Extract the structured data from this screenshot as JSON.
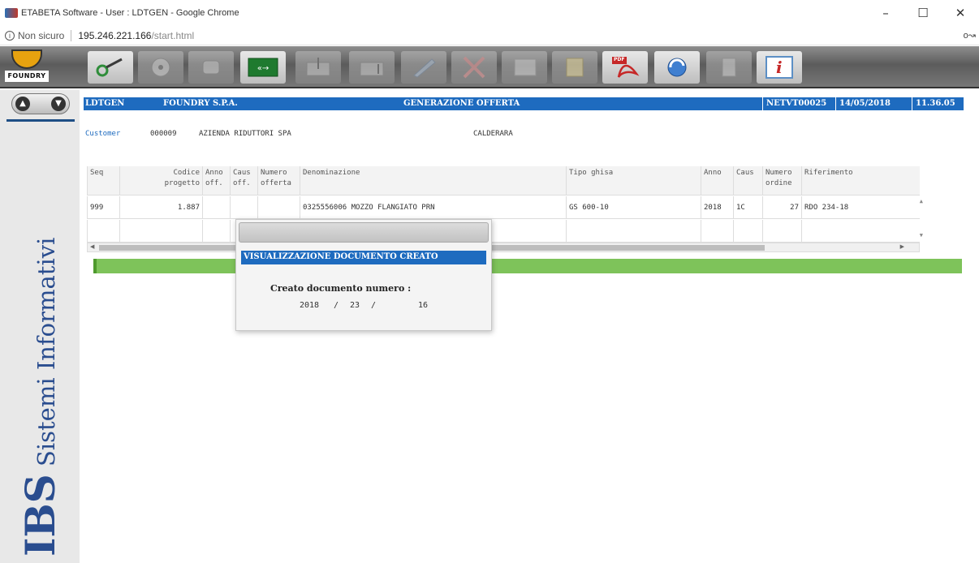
{
  "window": {
    "title": "ETABETA Software - User : LDTGEN - Google Chrome",
    "minimize": "–",
    "maximize": "☐",
    "close": "✕"
  },
  "address_bar": {
    "security": "Non sicuro",
    "host": "195.246.221.166",
    "path": "/start.html",
    "info_glyph": "i",
    "key_glyph": "o↝"
  },
  "toolbar": {
    "logo_text": "FOUNDRY",
    "buttons": [
      {
        "icon": "key-icon"
      },
      {
        "icon": "disc-icon"
      },
      {
        "icon": "eraser-icon"
      },
      {
        "icon": "exit-sign-icon"
      },
      {
        "icon": "download-icon"
      },
      {
        "icon": "upload-icon"
      },
      {
        "icon": "pencil-icon"
      },
      {
        "icon": "delete-icon"
      },
      {
        "icon": "copy-icon"
      },
      {
        "icon": "folder-icon"
      },
      {
        "icon": "pdf-icon",
        "label": "PDF"
      },
      {
        "icon": "refresh-icon"
      },
      {
        "icon": "calculator-icon"
      },
      {
        "icon": "info-icon",
        "label": "i"
      }
    ]
  },
  "sidebar": {
    "brand_ibs": "IBS",
    "brand_rest": " Sistemi Informativi",
    "prev": "▲",
    "next": "▼"
  },
  "header": {
    "user": "LDTGEN",
    "company": "FOUNDRY S.P.A.",
    "function": "GENERAZIONE OFFERTA",
    "program": "NETVT00025",
    "date": "14/05/2018",
    "time": "11.36.05"
  },
  "customer": {
    "label": "Customer",
    "code": "000009",
    "name": "AZIENDA RIDUTTORI SPA",
    "city": "CALDERARA"
  },
  "grid": {
    "columns": [
      {
        "l1": "Seq",
        "l2": ""
      },
      {
        "l1": "Codice",
        "l2": "progetto"
      },
      {
        "l1": "Anno",
        "l2": "off."
      },
      {
        "l1": "Caus",
        "l2": "off."
      },
      {
        "l1": "Numero",
        "l2": "offerta"
      },
      {
        "l1": "Denominazione",
        "l2": ""
      },
      {
        "l1": "Tipo ghisa",
        "l2": ""
      },
      {
        "l1": "Anno",
        "l2": ""
      },
      {
        "l1": "Caus",
        "l2": ""
      },
      {
        "l1": "Numero",
        "l2": "ordine"
      },
      {
        "l1": "Riferimento",
        "l2": ""
      }
    ],
    "rows": [
      [
        "999",
        "1.887",
        "",
        "",
        "",
        "0325556006 MOZZO FLANGIATO PRN",
        "GS 600-10",
        "2018",
        "1C",
        "27",
        "RDO 234-18"
      ],
      [
        "",
        "",
        "",
        "",
        "",
        "",
        "",
        "",
        "",
        "",
        ""
      ]
    ]
  },
  "modal": {
    "header": "VISUALIZZAZIONE DOCUMENTO CREATO",
    "label": "Creato documento numero :",
    "year": "2018",
    "sep1": "/",
    "number": "23",
    "sep2": "/",
    "suffix": "16"
  },
  "colors": {
    "header_blue": "#1e6bbf",
    "status_green": "#7ec35a",
    "brand_blue": "#2a4d8f"
  }
}
